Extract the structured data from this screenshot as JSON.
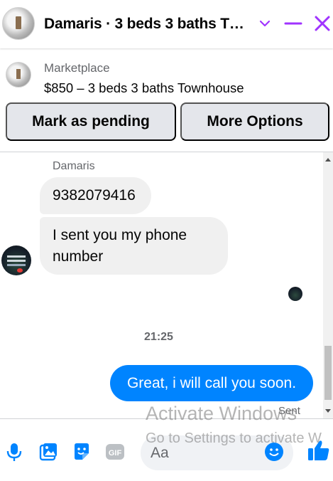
{
  "header": {
    "title": "Damaris · 3 beds 3 baths T…",
    "icons": [
      "chevron-down-icon",
      "minimize-icon",
      "close-icon"
    ]
  },
  "marketplace": {
    "label": "Marketplace",
    "listing": "$850 – 3 beds 3 baths Townhouse"
  },
  "actions": {
    "pending_label": "Mark as pending",
    "more_label": "More Options"
  },
  "messages": {
    "sender_name": "Damaris",
    "incoming": [
      {
        "text": "9382079416"
      },
      {
        "text": "I sent you my phone number"
      }
    ],
    "timestamp": "21:25",
    "outgoing": [
      {
        "text": "Great, i will call you soon."
      }
    ],
    "status": "Sent"
  },
  "composer": {
    "placeholder": "Aa",
    "icons": [
      "microphone-icon",
      "photo-icon",
      "sticker-icon",
      "gif-icon",
      "emoji-icon",
      "like-icon"
    ]
  },
  "watermark": {
    "title": "Activate Windows",
    "subtitle": "Go to Settings to activate W"
  },
  "colors": {
    "accent": "#a033ff",
    "outgoing_bubble": "#0084ff",
    "icon_blue": "#0084ff",
    "incoming_bubble": "#f0f0f0"
  }
}
